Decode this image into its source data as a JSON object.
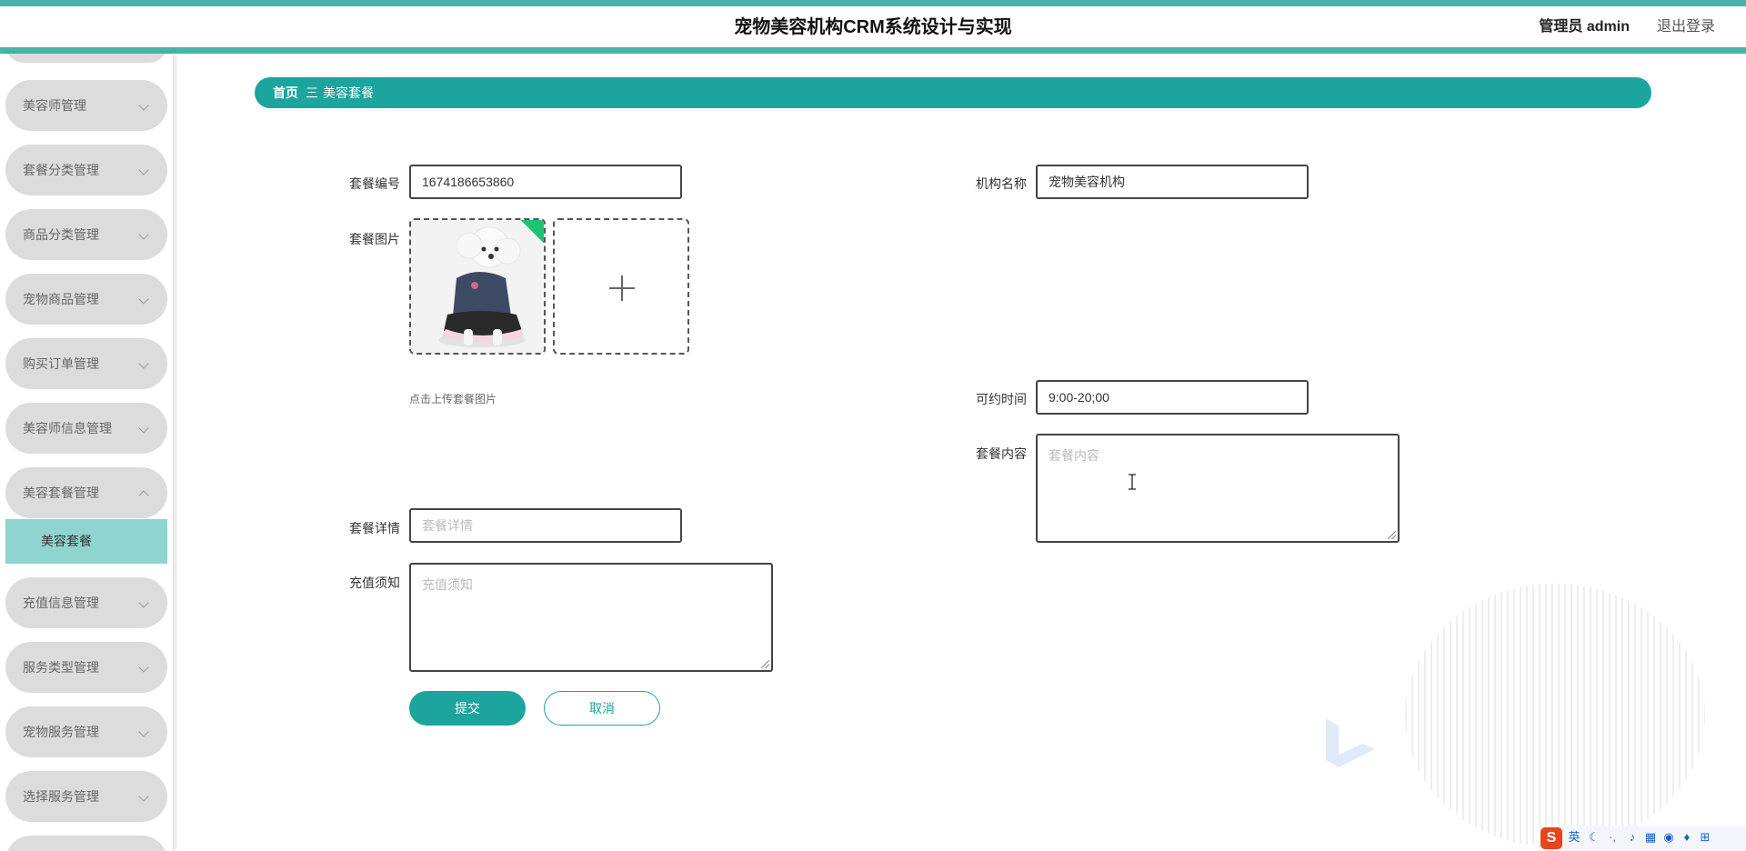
{
  "header": {
    "title": "宠物美容机构CRM系统设计与实现",
    "user": "管理员 admin",
    "logout": "退出登录"
  },
  "sidebar": {
    "items": [
      {
        "label": "美容师管理"
      },
      {
        "label": "套餐分类管理"
      },
      {
        "label": "商品分类管理"
      },
      {
        "label": "宠物商品管理"
      },
      {
        "label": "购买订单管理"
      },
      {
        "label": "美容师信息管理"
      },
      {
        "label": "美容套餐管理"
      },
      {
        "label": "充值信息管理"
      },
      {
        "label": "服务类型管理"
      },
      {
        "label": "宠物服务管理"
      },
      {
        "label": "选择服务管理"
      }
    ],
    "active_sub": "美容套餐"
  },
  "breadcrumb": {
    "home": "首页",
    "separator": "三",
    "current": "美容套餐"
  },
  "form": {
    "package_no": {
      "label": "套餐编号",
      "value": "1674186653860"
    },
    "org_name": {
      "label": "机构名称",
      "value": "宠物美容机构"
    },
    "package_image": {
      "label": "套餐图片",
      "hint": "点击上传套餐图片"
    },
    "available_time": {
      "label": "可约时间",
      "value": "9:00-20;00"
    },
    "package_content": {
      "label": "套餐内容",
      "placeholder": "套餐内容"
    },
    "package_detail": {
      "label": "套餐详情",
      "placeholder": "套餐详情"
    },
    "recharge_notice": {
      "label": "充值须知",
      "placeholder": "充值须知"
    },
    "submit": "提交",
    "cancel": "取消"
  },
  "ime": {
    "logo": "S",
    "lang": "英"
  }
}
